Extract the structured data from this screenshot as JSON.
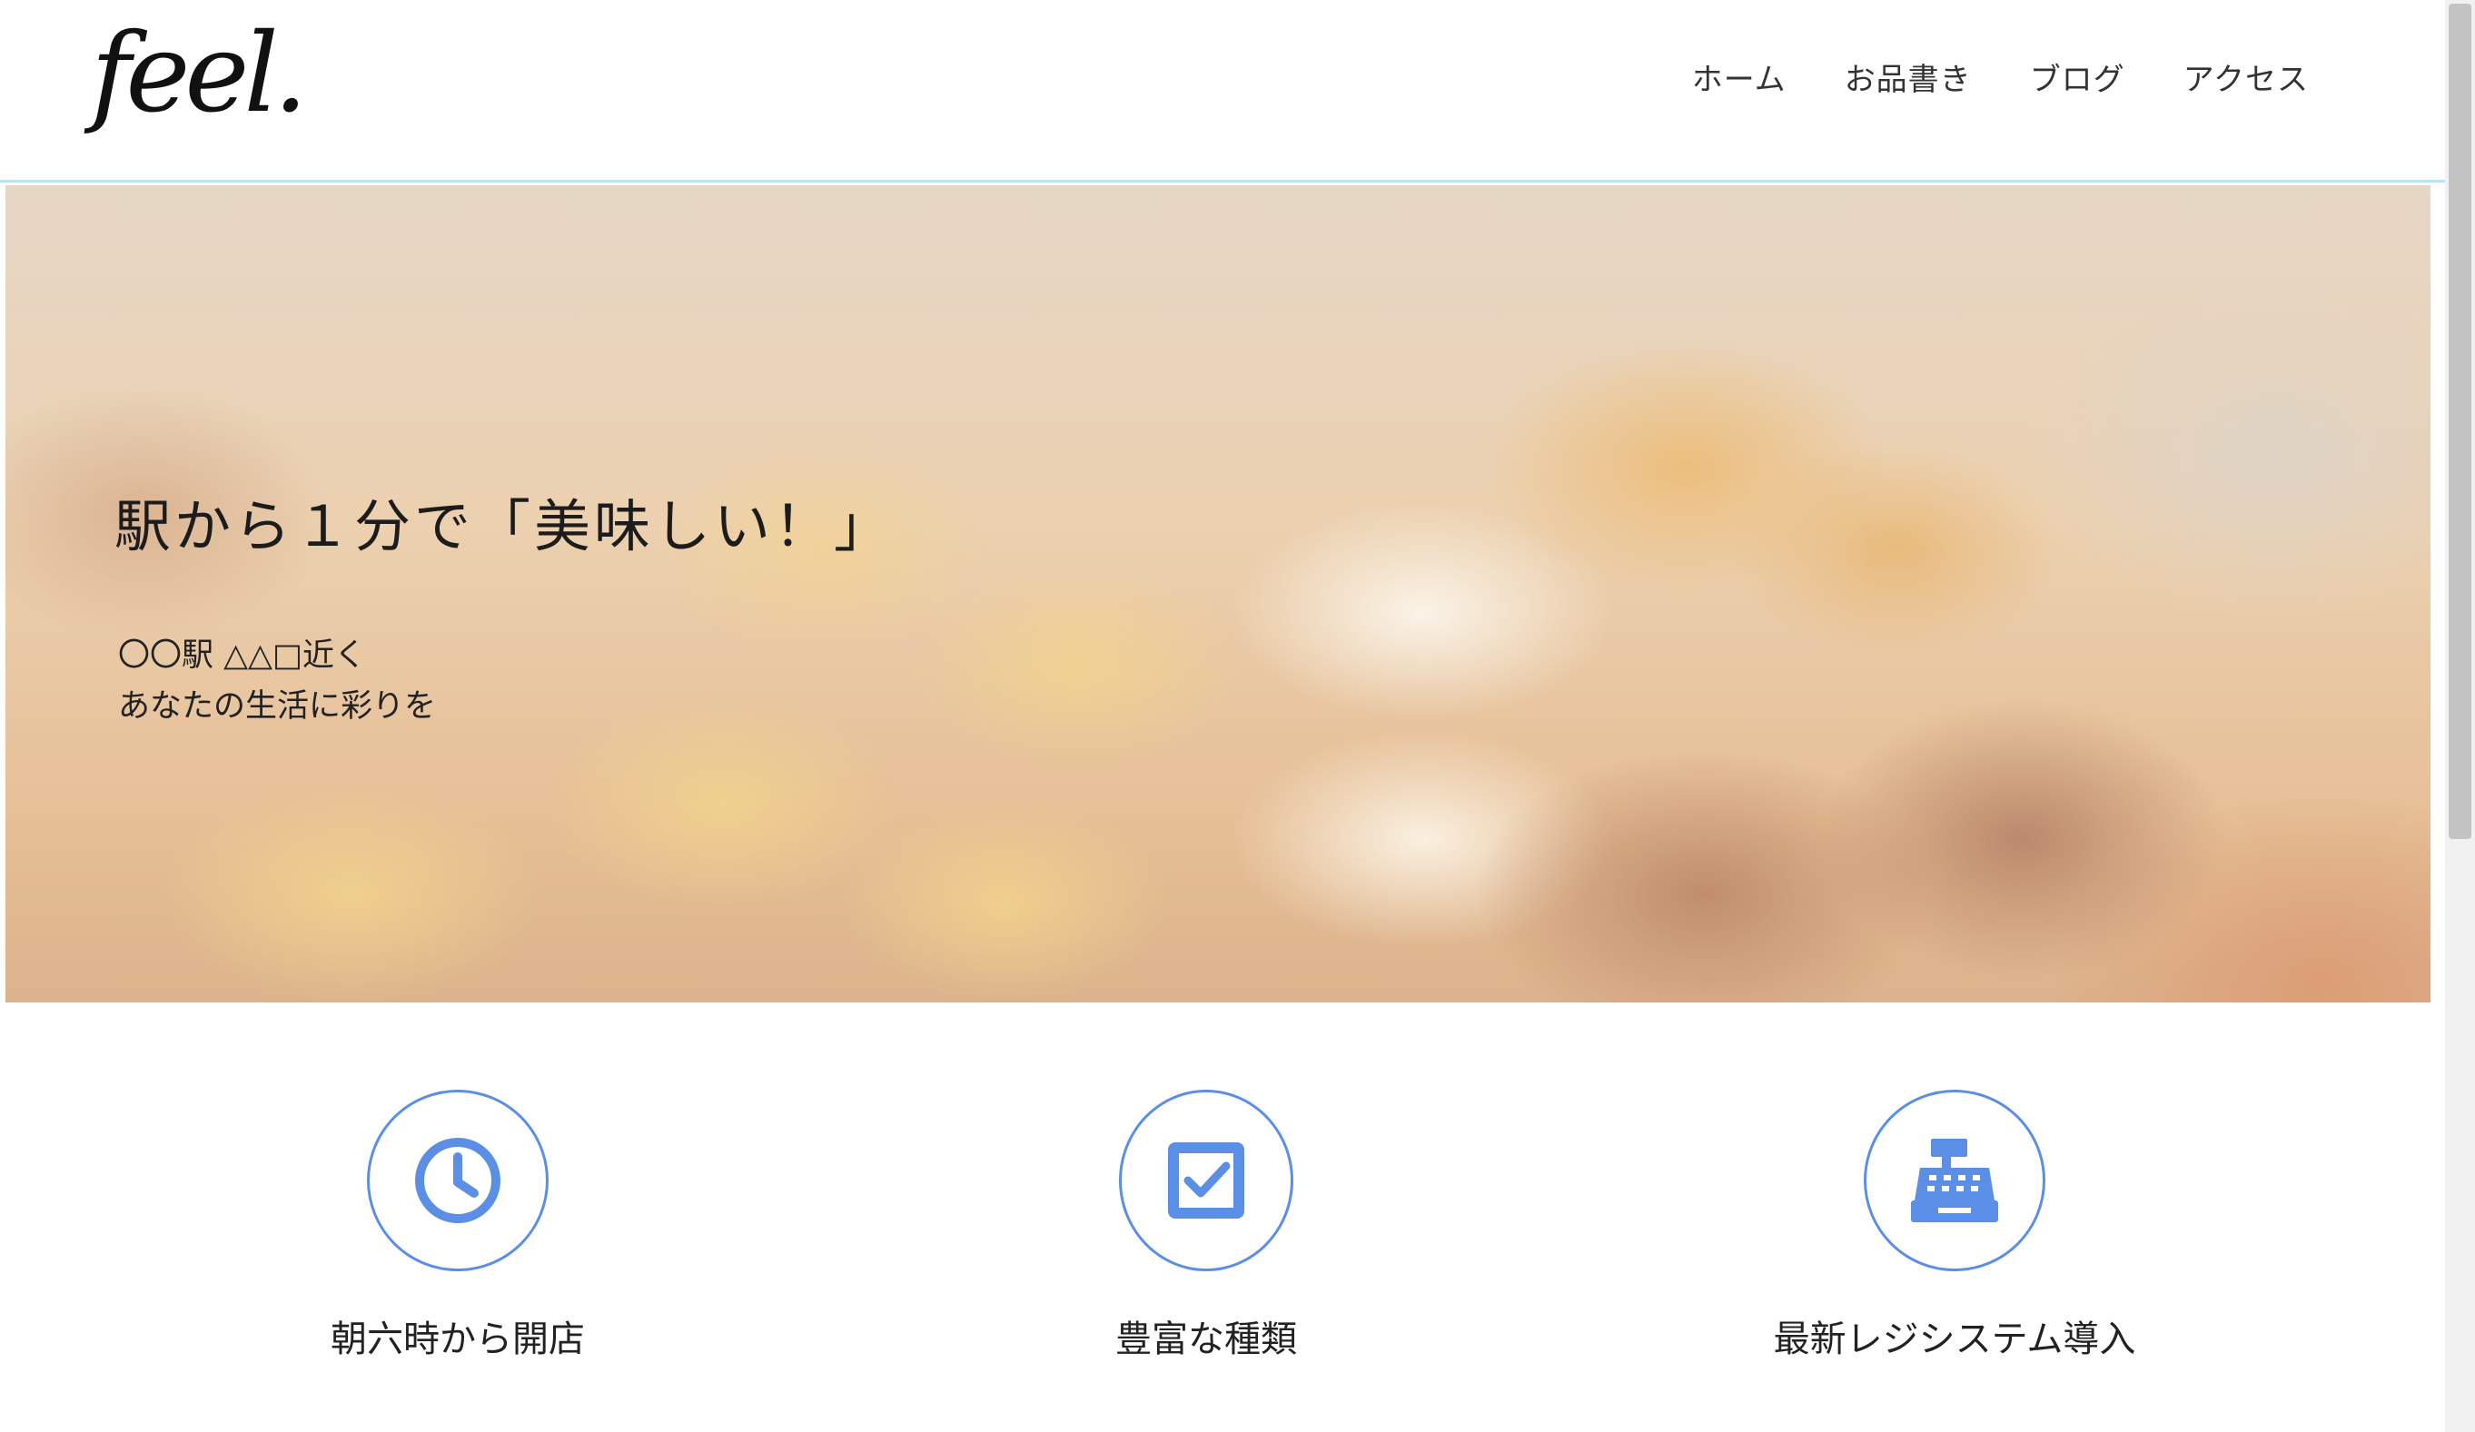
{
  "header": {
    "logo_text": "feel.",
    "nav": [
      "ホーム",
      "お品書き",
      "ブログ",
      "アクセス"
    ]
  },
  "hero": {
    "title": "駅から１分で「美味しい！」",
    "subtitle_line1": "〇〇駅 △△□近く",
    "subtitle_line2": "あなたの生活に彩りを"
  },
  "features": [
    {
      "icon": "clock-icon",
      "label": "朝六時から開店"
    },
    {
      "icon": "checkbox-icon",
      "label": "豊富な種類"
    },
    {
      "icon": "cash-register-icon",
      "label": "最新レジシステム導入"
    }
  ],
  "colors": {
    "accent": "#5b8fe6",
    "header_border": "#bfe3ee"
  }
}
